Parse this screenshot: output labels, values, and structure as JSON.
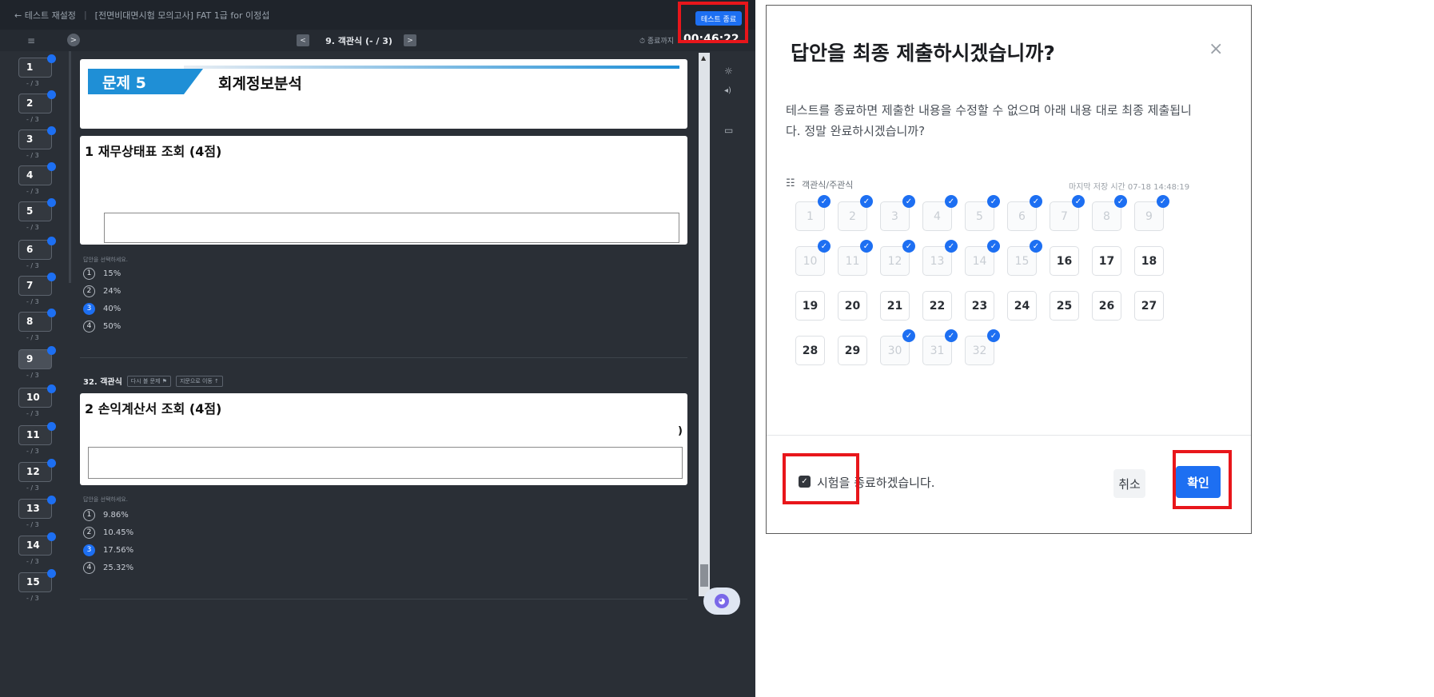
{
  "exam": {
    "topbar": {
      "back_label": "← 테스트 재설정",
      "title": "[전면비대면시험 모의고사] FAT 1급 for 이정섭",
      "end_button": "테스트 종료"
    },
    "navbar": {
      "list_icon": "≡",
      "expand_icon": ">",
      "prev": "<",
      "next": ">",
      "question_title": "9. 객관식 (- / 3)",
      "timer_label": "⏱ 종료까지",
      "timer": "00:46:22"
    },
    "sidebar": {
      "items": [
        {
          "num": "1",
          "score": "- / 3"
        },
        {
          "num": "2",
          "score": "- / 3"
        },
        {
          "num": "3",
          "score": "- / 3"
        },
        {
          "num": "4",
          "score": "- / 3"
        },
        {
          "num": "5",
          "score": "- / 3"
        },
        {
          "num": "6",
          "score": "- / 3"
        },
        {
          "num": "7",
          "score": "- / 3"
        },
        {
          "num": "8",
          "score": "- / 3"
        },
        {
          "num": "9",
          "score": "- / 3"
        },
        {
          "num": "10",
          "score": "- / 3"
        },
        {
          "num": "11",
          "score": "- / 3"
        },
        {
          "num": "12",
          "score": "- / 3"
        },
        {
          "num": "13",
          "score": "- / 3"
        },
        {
          "num": "14",
          "score": "- / 3"
        },
        {
          "num": "15",
          "score": "- / 3"
        }
      ]
    },
    "problem_banner": {
      "tab": "문제 5",
      "title": "회계정보분석"
    },
    "q1": {
      "heading": "1 재무상태표 조회 (4점)",
      "choices_label": "답안을 선택하세요.",
      "choices": [
        {
          "mark": "1",
          "text": "15%"
        },
        {
          "mark": "2",
          "text": "24%"
        },
        {
          "mark": "3",
          "text": "40%"
        },
        {
          "mark": "4",
          "text": "50%"
        }
      ]
    },
    "q32": {
      "label": "32. 객관식",
      "flag_button": "다시 볼 문제 ⚑",
      "move_button": "지문으로 이동 ↑"
    },
    "q2": {
      "heading": "2 손익계산서 조회 (4점)",
      "paren": ")",
      "choices_label": "답안을 선택하세요.",
      "choices": [
        {
          "mark": "1",
          "text": "9.86%"
        },
        {
          "mark": "2",
          "text": "10.45%"
        },
        {
          "mark": "3",
          "text": "17.56%"
        },
        {
          "mark": "4",
          "text": "25.32%"
        }
      ]
    },
    "tools": {
      "settings_icon": "☼",
      "sound_icon": "◂)",
      "memo_icon": "▭"
    },
    "chat_icon": "◕"
  },
  "modal": {
    "title": "답안을 최종 제출하시겠습니까?",
    "close": "×",
    "description": "테스트를 종료하면 제출한 내용을 수정할 수 없으며 아래 내용 대로 최종 제출됩니다. 정말 완료하시겠습니까?",
    "section_icon": "☷",
    "section_label": "객관식/주관식",
    "last_saved": "마지막 저장 시간 07-18 14:48:19",
    "tiles": [
      {
        "num": "1",
        "answered": true
      },
      {
        "num": "2",
        "answered": true
      },
      {
        "num": "3",
        "answered": true
      },
      {
        "num": "4",
        "answered": true
      },
      {
        "num": "5",
        "answered": true
      },
      {
        "num": "6",
        "answered": true
      },
      {
        "num": "7",
        "answered": true
      },
      {
        "num": "8",
        "answered": true
      },
      {
        "num": "9",
        "answered": true
      },
      {
        "num": "10",
        "answered": true
      },
      {
        "num": "11",
        "answered": true
      },
      {
        "num": "12",
        "answered": true
      },
      {
        "num": "13",
        "answered": true
      },
      {
        "num": "14",
        "answered": true
      },
      {
        "num": "15",
        "answered": true
      },
      {
        "num": "16",
        "answered": false
      },
      {
        "num": "17",
        "answered": false
      },
      {
        "num": "18",
        "answered": false
      },
      {
        "num": "19",
        "answered": false
      },
      {
        "num": "20",
        "answered": false
      },
      {
        "num": "21",
        "answered": false
      },
      {
        "num": "22",
        "answered": false
      },
      {
        "num": "23",
        "answered": false
      },
      {
        "num": "24",
        "answered": false
      },
      {
        "num": "25",
        "answered": false
      },
      {
        "num": "26",
        "answered": false
      },
      {
        "num": "27",
        "answered": false
      },
      {
        "num": "28",
        "answered": false
      },
      {
        "num": "29",
        "answered": false
      },
      {
        "num": "30",
        "answered": true
      },
      {
        "num": "31",
        "answered": true
      },
      {
        "num": "32",
        "answered": true
      }
    ],
    "confirm_checkbox_label": "시험을 종료하겠습니다.",
    "cancel": "취소",
    "confirm": "확인"
  },
  "colors": {
    "accent": "#1d6ff2",
    "highlight": "#e8161b",
    "exam_bg": "#2a2f36"
  }
}
